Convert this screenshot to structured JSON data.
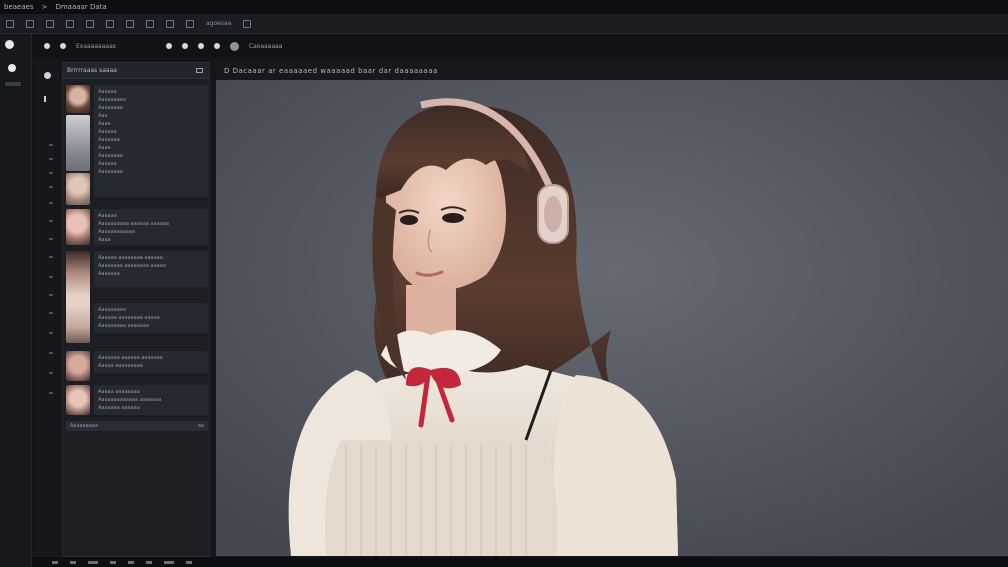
{
  "titlebar": {
    "app_title": "beaeaes",
    "separator": ">",
    "doc_title": "Dmaaaar Data"
  },
  "toolbar": {
    "label": "agoesaa"
  },
  "subheader": {
    "title": "Exaaaaaaaas",
    "status": "Caoaaaaaa"
  },
  "history": {
    "title": "Brrrrraaas saaaa",
    "rows": [
      {
        "lines": [
          "Aaaaaa",
          "Aaaaaaaaa",
          "Aaaaaaaa",
          "Aaa",
          "Aaaa",
          "Aaaaaa",
          "Aaaaaaa",
          "Aaaa",
          "Aaaaaaaa",
          "Aaaaaa",
          "Aaaaaaaa"
        ]
      },
      {
        "lines": [
          "Aaaaaa",
          "Aaaaaaaaaa aaaaaa aaaaaa",
          "Aaaaaaaaaaaa",
          "Aaaa"
        ]
      },
      {
        "lines": [
          "Aaaaaa aaaaaaaa aaaaaa",
          "Aaaaaaaa aaaaaaaa aaaaa",
          "Aaaaaaa"
        ]
      },
      {
        "lines": [
          "Aaaaaaaaa",
          "Aaaaaa aaaaaaaa aaaaa",
          "Aaaaaaaaa aaaaaaa"
        ]
      },
      {
        "lines": [
          "Aaaaaaa aaaaaa aaaaaaa",
          "Aaaaa aaaaaaaaa"
        ]
      },
      {
        "lines": [
          "Aaaaa aaaaaaaa",
          "Aaaaaaaaaaaaa aaaaaaa",
          "Aaaaaaa aaaaaa"
        ]
      }
    ],
    "footer_label": "Aaaaaaaaa",
    "footer_count": "aa"
  },
  "canvas": {
    "caption": "D  Dacaaar  ar  eaaaaaed  waaaaad  baar  dar  daaaaaaaa"
  },
  "colors": {
    "accent_ribbon": "#c4263a",
    "hair": "#4a2f24",
    "skin": "#e9c6b3",
    "blouse": "#eee4d8"
  }
}
